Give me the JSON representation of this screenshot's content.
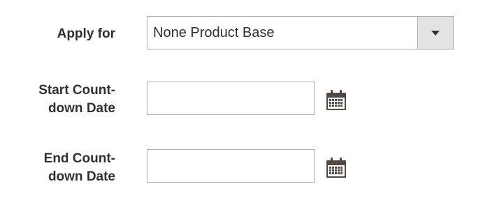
{
  "form": {
    "apply_for": {
      "label": "Apply for",
      "selected": "None Product Base",
      "toggle_icon": "chevron-down-icon"
    },
    "start_date": {
      "label_line1": "Start Count-",
      "label_line2": "down Date",
      "value": "",
      "icon": "calendar-icon"
    },
    "end_date": {
      "label_line1": "End Count-",
      "label_line2": "down Date",
      "value": "",
      "icon": "calendar-icon"
    }
  },
  "colors": {
    "label_text": "#303030",
    "border": "#adadad",
    "toggle_bg": "#e3e3e3",
    "icon": "#514943"
  }
}
